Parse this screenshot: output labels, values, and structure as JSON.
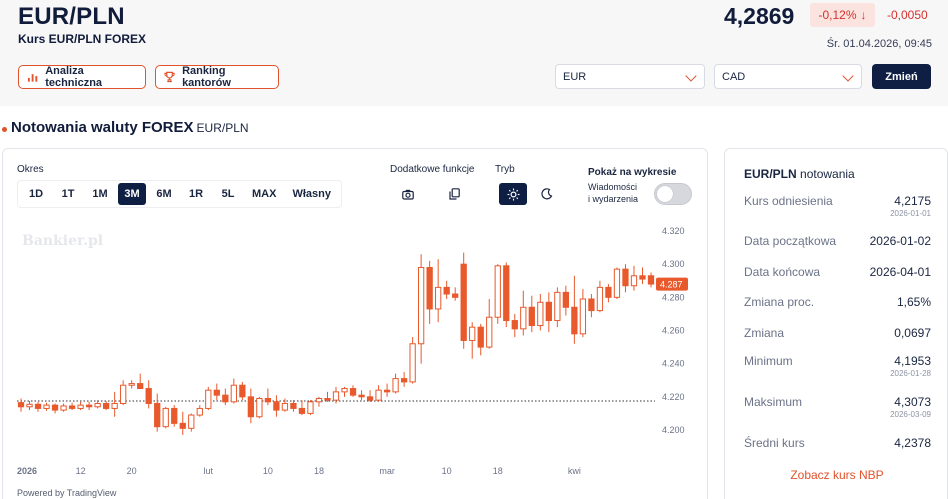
{
  "header": {
    "title": "EUR/PLN",
    "subtitle": "Kurs EUR/PLN FOREX",
    "price": "4,2869",
    "change_pct": "-0,12%",
    "change_arrow": "↓",
    "change_abs": "-0,0050",
    "datetime": "Śr. 01.04.2026, 09:45"
  },
  "actions": {
    "technical": "Analiza techniczna",
    "ranking": "Ranking kantorów"
  },
  "converter": {
    "from": "EUR",
    "to": "CAD",
    "submit": "Zmień"
  },
  "section": {
    "title": "Notowania waluty FOREX",
    "pair": "EUR/PLN"
  },
  "chart_controls": {
    "period_label": "Okres",
    "periods": [
      "1D",
      "1T",
      "1M",
      "3M",
      "6M",
      "1R",
      "5L",
      "MAX",
      "Własny"
    ],
    "active_period": "3M",
    "extra_label": "Dodatkowe funkcje",
    "mode_label": "Tryb",
    "show_label": "Pokaż na wykresie",
    "news_label_1": "Wiadomości",
    "news_label_2": "i wydarzenia",
    "watermark": "Bankier.pl",
    "powered": "Powered by TradingView"
  },
  "chart_data": {
    "type": "candlestick",
    "y_ticks": [
      "4.320",
      "4.300",
      "4.280",
      "4.260",
      "4.240",
      "4.220",
      "4.200"
    ],
    "ylim": [
      4.195,
      4.322
    ],
    "x_ticks": [
      {
        "label": "2026",
        "idx": 0
      },
      {
        "label": "12",
        "idx": 7
      },
      {
        "label": "20",
        "idx": 13
      },
      {
        "label": "lut",
        "idx": 22
      },
      {
        "label": "10",
        "idx": 29
      },
      {
        "label": "18",
        "idx": 35
      },
      {
        "label": "mar",
        "idx": 43
      },
      {
        "label": "10",
        "idx": 50
      },
      {
        "label": "18",
        "idx": 56
      },
      {
        "label": "kwi",
        "idx": 65
      }
    ],
    "last_price_label": "4.287",
    "reference_level": 4.2175,
    "up_color": "#e8592c",
    "down_color": "#e8592c",
    "candles": [
      [
        4.2165,
        4.219,
        4.211,
        4.214
      ],
      [
        4.214,
        4.2175,
        4.212,
        4.2155
      ],
      [
        4.2155,
        4.217,
        4.211,
        4.213
      ],
      [
        4.213,
        4.2165,
        4.2115,
        4.215
      ],
      [
        4.215,
        4.216,
        4.21,
        4.212
      ],
      [
        4.212,
        4.216,
        4.211,
        4.2145
      ],
      [
        4.2145,
        4.2165,
        4.212,
        4.213
      ],
      [
        4.213,
        4.217,
        4.212,
        4.215
      ],
      [
        4.215,
        4.217,
        4.212,
        4.214
      ],
      [
        4.214,
        4.218,
        4.213,
        4.216
      ],
      [
        4.216,
        4.2175,
        4.212,
        4.213
      ],
      [
        4.213,
        4.223,
        4.208,
        4.216
      ],
      [
        4.216,
        4.23,
        4.215,
        4.227
      ],
      [
        4.227,
        4.23,
        4.225,
        4.228
      ],
      [
        4.228,
        4.234,
        4.226,
        4.225
      ],
      [
        4.225,
        4.23,
        4.213,
        4.216
      ],
      [
        4.216,
        4.222,
        4.199,
        4.202
      ],
      [
        4.202,
        4.214,
        4.201,
        4.213
      ],
      [
        4.213,
        4.215,
        4.202,
        4.204
      ],
      [
        4.204,
        4.211,
        4.197,
        4.201
      ],
      [
        4.201,
        4.21,
        4.199,
        4.209
      ],
      [
        4.209,
        4.215,
        4.208,
        4.213
      ],
      [
        4.213,
        4.226,
        4.212,
        4.224
      ],
      [
        4.224,
        4.228,
        4.218,
        4.221
      ],
      [
        4.221,
        4.225,
        4.215,
        4.217
      ],
      [
        4.217,
        4.231,
        4.216,
        4.227
      ],
      [
        4.227,
        4.229,
        4.218,
        4.22
      ],
      [
        4.22,
        4.225,
        4.204,
        4.208
      ],
      [
        4.208,
        4.22,
        4.207,
        4.219
      ],
      [
        4.219,
        4.225,
        4.215,
        4.217
      ],
      [
        4.217,
        4.221,
        4.208,
        4.212
      ],
      [
        4.212,
        4.219,
        4.211,
        4.216
      ],
      [
        4.216,
        4.218,
        4.211,
        4.213
      ],
      [
        4.213,
        4.218,
        4.209,
        4.21
      ],
      [
        4.21,
        4.218,
        4.209,
        4.217
      ],
      [
        4.217,
        4.22,
        4.214,
        4.219
      ],
      [
        4.219,
        4.223,
        4.217,
        4.218
      ],
      [
        4.218,
        4.226,
        4.216,
        4.223
      ],
      [
        4.223,
        4.226,
        4.22,
        4.225
      ],
      [
        4.225,
        4.227,
        4.22,
        4.221
      ],
      [
        4.221,
        4.224,
        4.218,
        4.22
      ],
      [
        4.22,
        4.224,
        4.217,
        4.218
      ],
      [
        4.218,
        4.227,
        4.217,
        4.224
      ],
      [
        4.224,
        4.228,
        4.22,
        4.223
      ],
      [
        4.223,
        4.234,
        4.222,
        4.231
      ],
      [
        4.231,
        4.235,
        4.226,
        4.229
      ],
      [
        4.229,
        4.256,
        4.228,
        4.252
      ],
      [
        4.252,
        4.306,
        4.24,
        4.298
      ],
      [
        4.298,
        4.302,
        4.264,
        4.273
      ],
      [
        4.273,
        4.303,
        4.265,
        4.286
      ],
      [
        4.286,
        4.29,
        4.279,
        4.282
      ],
      [
        4.282,
        4.286,
        4.278,
        4.28
      ],
      [
        4.3,
        4.307,
        4.249,
        4.254
      ],
      [
        4.254,
        4.265,
        4.243,
        4.262
      ],
      [
        4.262,
        4.264,
        4.245,
        4.25
      ],
      [
        4.25,
        4.279,
        4.249,
        4.268
      ],
      [
        4.268,
        4.3,
        4.264,
        4.299
      ],
      [
        4.299,
        4.301,
        4.262,
        4.266
      ],
      [
        4.266,
        4.27,
        4.256,
        4.261
      ],
      [
        4.261,
        4.284,
        4.257,
        4.274
      ],
      [
        4.274,
        4.281,
        4.259,
        4.263
      ],
      [
        4.263,
        4.282,
        4.26,
        4.277
      ],
      [
        4.277,
        4.283,
        4.259,
        4.266
      ],
      [
        4.266,
        4.286,
        4.262,
        4.283
      ],
      [
        4.283,
        4.287,
        4.269,
        4.274
      ],
      [
        4.274,
        4.293,
        4.252,
        4.258
      ],
      [
        4.258,
        4.285,
        4.256,
        4.279
      ],
      [
        4.279,
        4.282,
        4.268,
        4.272
      ],
      [
        4.272,
        4.29,
        4.271,
        4.286
      ],
      [
        4.286,
        4.288,
        4.277,
        4.28
      ],
      [
        4.28,
        4.298,
        4.279,
        4.297
      ],
      [
        4.297,
        4.3,
        4.283,
        4.287
      ],
      [
        4.287,
        4.299,
        4.284,
        4.293
      ],
      [
        4.293,
        4.298,
        4.288,
        4.291
      ],
      [
        4.293,
        4.295,
        4.286,
        4.288
      ]
    ]
  },
  "stats": {
    "title_pair": "EUR/PLN",
    "title_rest": "notowania",
    "rows": [
      {
        "label": "Kurs odniesienia",
        "value": "4,2175",
        "date": "2026-01-01"
      },
      {
        "label": "Data początkowa",
        "value": "2026-01-02",
        "date": ""
      },
      {
        "label": "Data końcowa",
        "value": "2026-04-01",
        "date": ""
      },
      {
        "label": "Zmiana proc.",
        "value": "1,65%",
        "date": ""
      },
      {
        "label": "Zmiana",
        "value": "0,0697",
        "date": ""
      },
      {
        "label": "Minimum",
        "value": "4,1953",
        "date": "2026-01-28"
      },
      {
        "label": "Maksimum",
        "value": "4,3073",
        "date": "2026-03-09"
      },
      {
        "label": "Średni kurs",
        "value": "4,2378",
        "date": ""
      }
    ],
    "link": "Zobacz kurs NBP"
  },
  "colors": {
    "accent": "#e0532b",
    "navy": "#0f1f44",
    "negative": "#d4322c"
  }
}
